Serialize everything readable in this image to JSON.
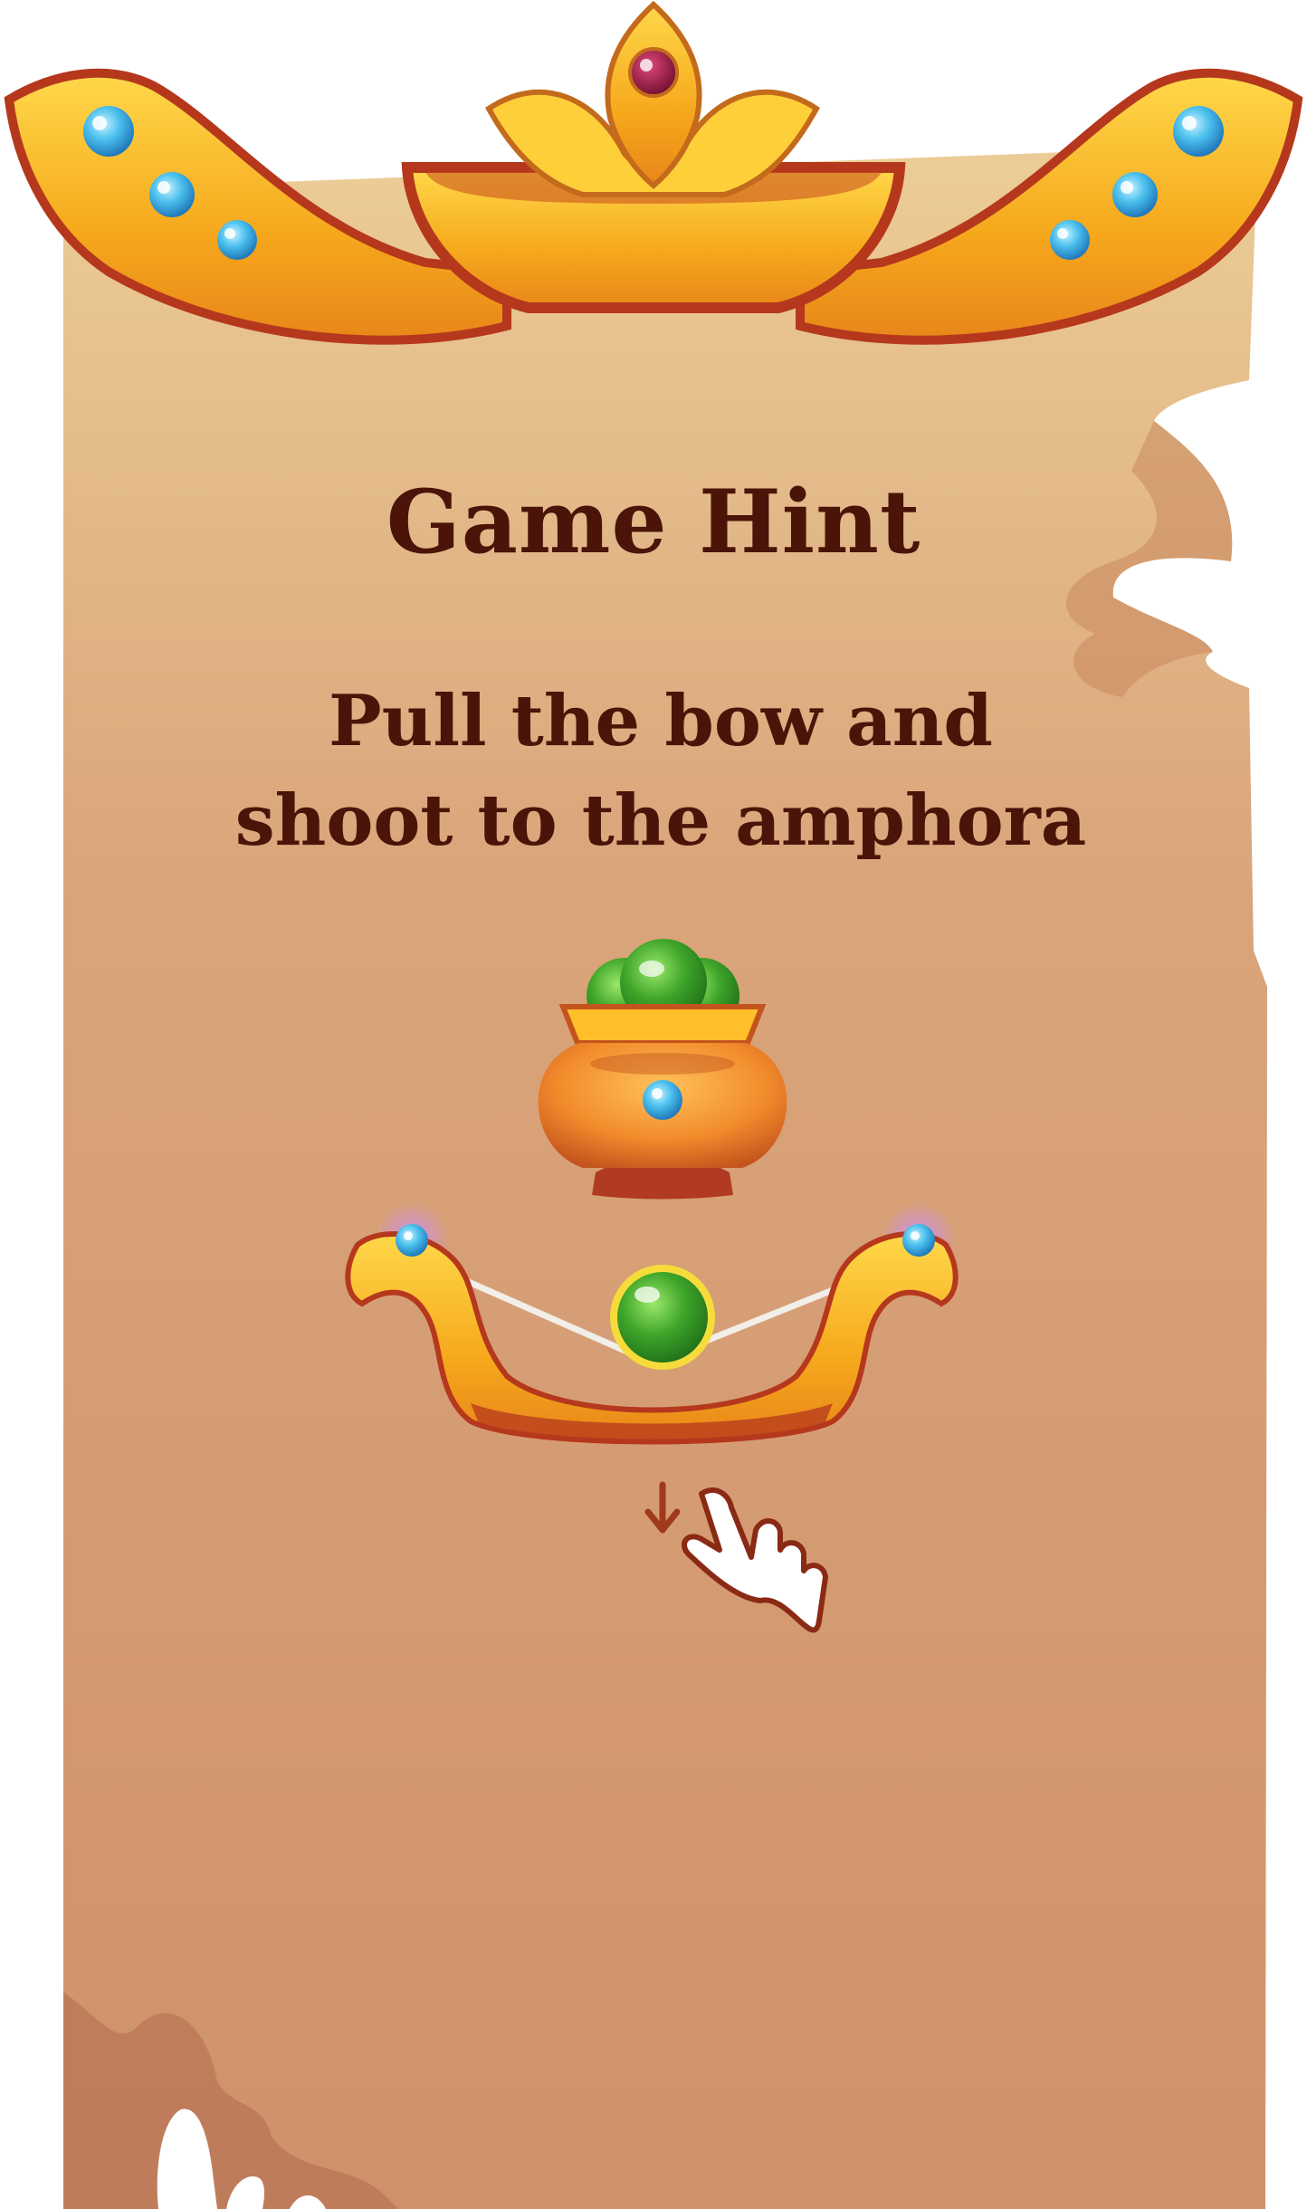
{
  "panel": {
    "title": "Game Hint",
    "hint_lines": [
      "Pull the bow and",
      "shoot to the amphora"
    ]
  },
  "icons": {
    "crown": "golden-crown-header",
    "amphora": "amphora-with-green-balls",
    "bow": "golden-bow",
    "ball": "green-ball",
    "arrow": "down-arrow-icon",
    "hand": "pointing-hand-icon"
  },
  "colors": {
    "parchment_top": "#e8c48e",
    "parchment_bottom": "#cf916b",
    "gold": "#f7b21a",
    "gold_dark": "#c4491d",
    "gem_blue": "#3fb6e8",
    "gem_red": "#8e1238",
    "ball_green": "#3ea52a",
    "text": "#4a1408"
  }
}
